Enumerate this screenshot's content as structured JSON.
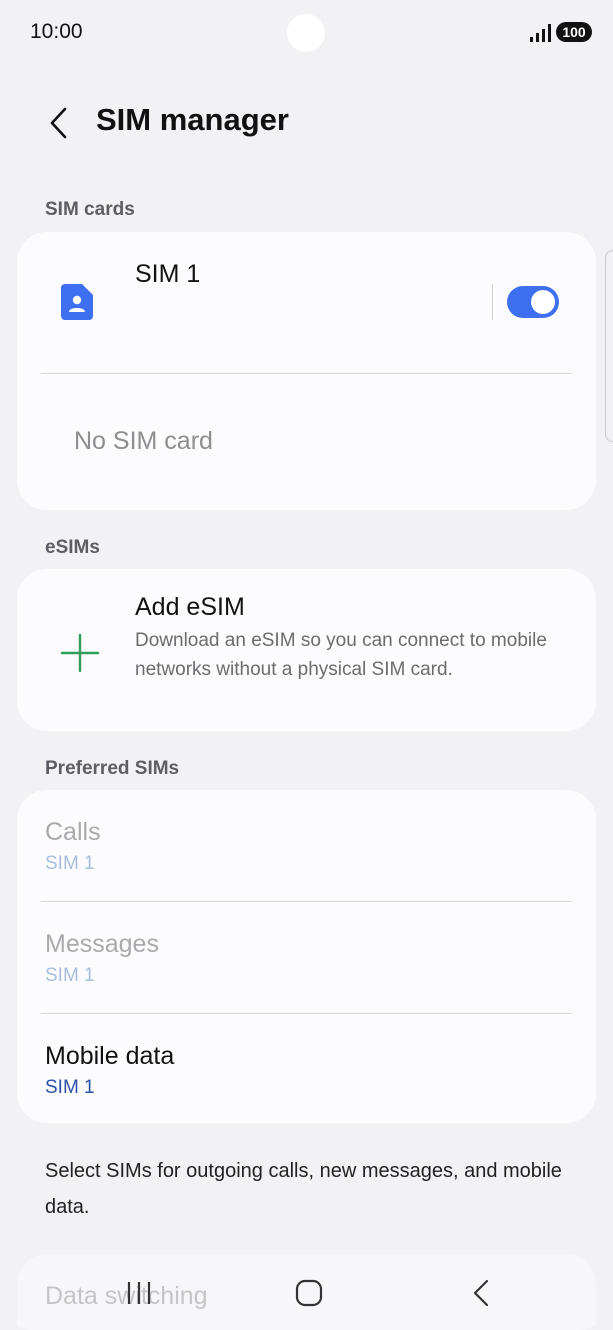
{
  "status_bar": {
    "time": "10:00",
    "battery": "100",
    "signal_icon": "signal-bars-icon"
  },
  "header": {
    "back_icon": "chevron-left-icon",
    "title": "SIM manager"
  },
  "sim_cards": {
    "section_label": "SIM cards",
    "sim1": {
      "icon": "sim-card-icon",
      "name": "SIM 1",
      "enabled": true,
      "accent_color": "#3e6ff0"
    },
    "empty_slot_text": "No SIM card"
  },
  "esims": {
    "section_label": "eSIMs",
    "add": {
      "icon": "plus-icon",
      "title": "Add eSIM",
      "description": "Download an eSIM so you can connect to mobile networks without a physical SIM card."
    }
  },
  "preferred_sims": {
    "section_label": "Preferred SIMs",
    "rows": [
      {
        "title": "Calls",
        "value": "SIM 1",
        "enabled": false
      },
      {
        "title": "Messages",
        "value": "SIM 1",
        "enabled": false
      },
      {
        "title": "Mobile data",
        "value": "SIM 1",
        "enabled": true
      }
    ],
    "footer": "Select SIMs for outgoing calls, new messages, and mobile data."
  },
  "data_switching": {
    "title": "Data switching"
  },
  "nav_bar": {
    "recents_icon": "recents-icon",
    "home_icon": "home-icon",
    "back_icon": "back-icon"
  }
}
